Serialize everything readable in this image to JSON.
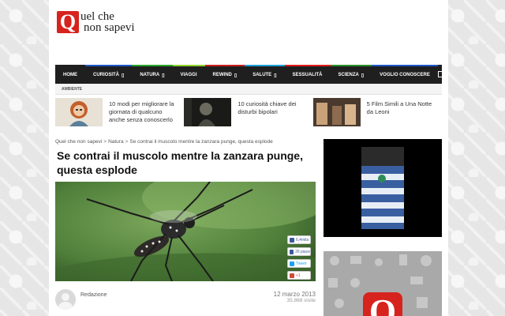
{
  "site": {
    "logo_letter": "Q",
    "logo_line1": "uel che",
    "logo_line2": "non sapevi",
    "brand_color": "#d6231e"
  },
  "nav": {
    "items": [
      {
        "label": "HOME",
        "caret": false,
        "accent": ""
      },
      {
        "label": "CURIOSITÀ",
        "caret": true,
        "accent": "#1e56c8"
      },
      {
        "label": "NATURA",
        "caret": true,
        "accent": "#2aa32a"
      },
      {
        "label": "VIAGGI",
        "caret": false,
        "accent": "#8fd12a"
      },
      {
        "label": "REWIND",
        "caret": true,
        "accent": "#c81e1e"
      },
      {
        "label": "SALUTE",
        "caret": true,
        "accent": "#1e9fd6"
      },
      {
        "label": "SESSUALITÀ",
        "caret": false,
        "accent": "#e31b1b"
      },
      {
        "label": "SCIENZA",
        "caret": true,
        "accent": "#2a8f2a"
      },
      {
        "label": "VOGLIO CONOSCERE",
        "caret": false,
        "accent": "#1e56c8"
      }
    ],
    "caret_glyph": "▯",
    "search_icon": "search-icon"
  },
  "subnav": {
    "label": "AMBIENTE"
  },
  "featured": [
    {
      "title": "10 modi per migliorare la giornata di qualcuno anche senza conoscerlo"
    },
    {
      "title": "10 curiosità chiave dei disturbi bipolari"
    },
    {
      "title": "5 Film Simili a Una Notte da Leoni"
    }
  ],
  "breadcrumb": {
    "home": "Quel che non sapevi",
    "sep": ">",
    "category": "Natura",
    "current": "Se contrai il muscolo mentre la zanzara punge, questa esplode"
  },
  "post": {
    "title": "Se contrai il muscolo mentre la zanzara punge, questa esplode",
    "author": "Redazione",
    "date": "12 marzo 2013",
    "views": "35.868 visite"
  },
  "share": {
    "like": "6,4mila",
    "fb": "26 piace",
    "tweet": "Tweet",
    "gplus": "+1"
  }
}
